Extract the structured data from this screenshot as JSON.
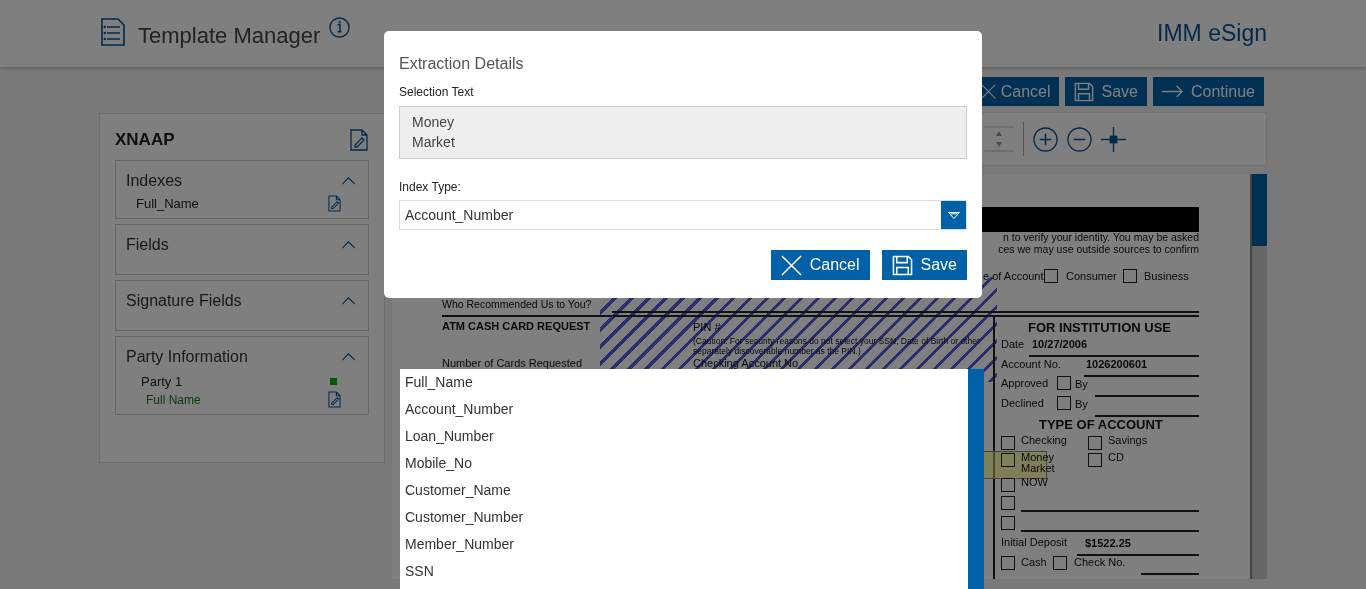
{
  "header": {
    "title": "Template Manager",
    "brand": "IMM eSign"
  },
  "sidebar": {
    "title": "XNAAP",
    "sections": [
      {
        "title": "Indexes",
        "expanded": true,
        "items": [
          {
            "label": "Full_Name",
            "kind": "field"
          }
        ]
      },
      {
        "title": "Fields",
        "expanded": true
      },
      {
        "title": "Signature Fields",
        "expanded": true
      },
      {
        "title": "Party Information",
        "expanded": true,
        "items": [
          {
            "label": "Party 1",
            "kind": "party",
            "color": "#005a00"
          },
          {
            "label": "Full Name",
            "kind": "party-field"
          }
        ]
      }
    ]
  },
  "actions": [
    {
      "label": "Cancel"
    },
    {
      "label": "Save"
    },
    {
      "label": "Continue"
    }
  ],
  "document": {
    "notice_lines": [
      "n to verify your identity. You may be asked",
      "ces we may use outside sources to confirm"
    ],
    "account_type": {
      "label": "e of Account",
      "options": [
        {
          "label": "Consumer",
          "checked": false
        },
        {
          "label": "Business",
          "checked": false
        }
      ]
    },
    "referral_label": "Who Recommended Us to You?",
    "atm": {
      "title": "ATM CASH CARD REQUEST",
      "pin_label": "PIN #",
      "caution": "(Caution: For security reasons do not select your SSN, Date of Birth or other separately discoverable number as the PIN.)",
      "cards_label": "Number of Cards Requested",
      "checking_label": "Checking Account No"
    },
    "institution": {
      "title": "FOR INSTITUTION USE",
      "date_label": "Date",
      "date": "10/27/2006",
      "account_label": "Account No.",
      "account": "1026200601",
      "approvals": [
        {
          "label": "Approved",
          "by": "By",
          "checked": false
        },
        {
          "label": "Declined",
          "by": "By",
          "checked": false
        }
      ],
      "type_title": "TYPE OF ACCOUNT",
      "types": [
        {
          "label": "Checking",
          "highlighted": false,
          "checked": false
        },
        {
          "label": "Savings",
          "highlighted": false,
          "checked": false
        },
        {
          "label": "Money Market",
          "highlighted": true,
          "checked": false
        },
        {
          "label": "CD",
          "highlighted": false,
          "checked": false
        },
        {
          "label": "NOW",
          "highlighted": false,
          "checked": false
        },
        {
          "highlighted": false,
          "checked": false
        },
        {
          "highlighted": false,
          "checked": false
        }
      ],
      "deposit_label": "Initial Deposit",
      "deposit": "$1522.25",
      "payments": [
        {
          "label": "Cash",
          "checked": false
        },
        {
          "label": "Check No.",
          "checked": false
        }
      ]
    }
  },
  "modal": {
    "title": "Extraction Details",
    "selection_label": "Selection Text",
    "selection_lines": [
      "Money",
      "Market"
    ],
    "index_label": "Index Type:",
    "index_value": "Account_Number",
    "buttons": [
      {
        "label": "Cancel"
      },
      {
        "label": "Save"
      }
    ]
  },
  "dropdown": {
    "options": [
      "Full_Name",
      "Account_Number",
      "Loan_Number",
      "Mobile_No",
      "Customer_Name",
      "Customer_Number",
      "Member_Number",
      "SSN"
    ]
  }
}
